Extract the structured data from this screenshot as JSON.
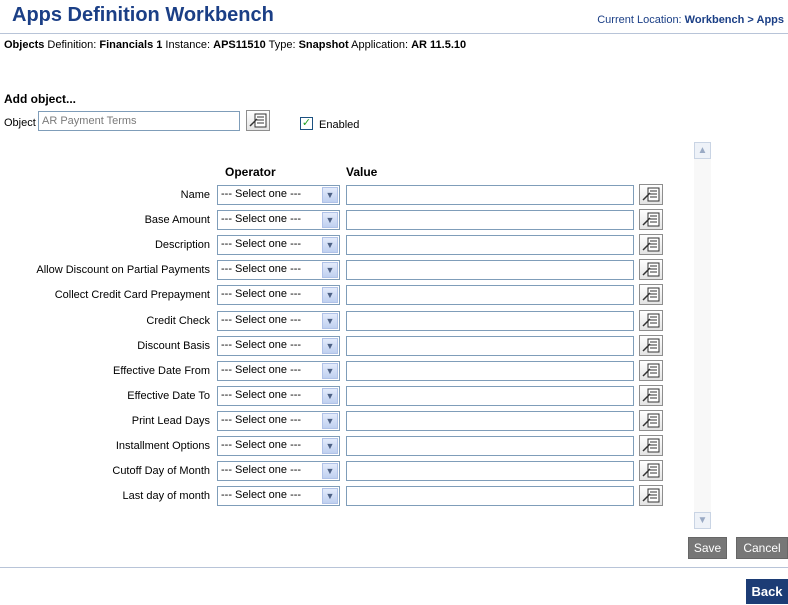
{
  "header": {
    "title": "Apps Definition Workbench",
    "location_prefix": "Current Location: ",
    "location_path": "Workbench > Apps"
  },
  "meta": {
    "objects_label": "Objects",
    "definition_label": " Definition: ",
    "definition_value": "Financials 1",
    "instance_label": " Instance: ",
    "instance_value": "APS11510",
    "type_label": " Type: ",
    "type_value": "Snapshot",
    "application_label": " Application: ",
    "application_value": "AR 11.5.10"
  },
  "add_object": {
    "heading": "Add object...",
    "object_label": "Object",
    "object_value": "AR Payment Terms",
    "enabled_label": "Enabled",
    "enabled": true
  },
  "criteria": {
    "operator_header": "Operator",
    "value_header": "Value",
    "select_placeholder": "--- Select one ---",
    "rows": [
      {
        "label": "Name"
      },
      {
        "label": "Base Amount"
      },
      {
        "label": "Description"
      },
      {
        "label": "Allow Discount on Partial Payments"
      },
      {
        "label": "Collect Credit Card Prepayment"
      },
      {
        "label": "Credit Check"
      },
      {
        "label": "Discount Basis"
      },
      {
        "label": "Effective Date From"
      },
      {
        "label": "Effective Date To"
      },
      {
        "label": "Print Lead Days"
      },
      {
        "label": "Installment Options"
      },
      {
        "label": "Cutoff Day of Month"
      },
      {
        "label": "Last day of month"
      }
    ]
  },
  "actions": {
    "save_label": "Save",
    "cancel_label": "Cancel",
    "back_label": "Back"
  },
  "icons": {
    "lov": "search-list-icon",
    "checkbox": "checkmark-icon",
    "dropdown": "chevron-down-icon",
    "scroll_up": "chevron-up-icon",
    "scroll_down": "chevron-down-icon"
  },
  "colors": {
    "title": "#1b3f86",
    "back_button": "#1c3c75",
    "action_button": "#777777",
    "checkmark": "#21a121"
  }
}
